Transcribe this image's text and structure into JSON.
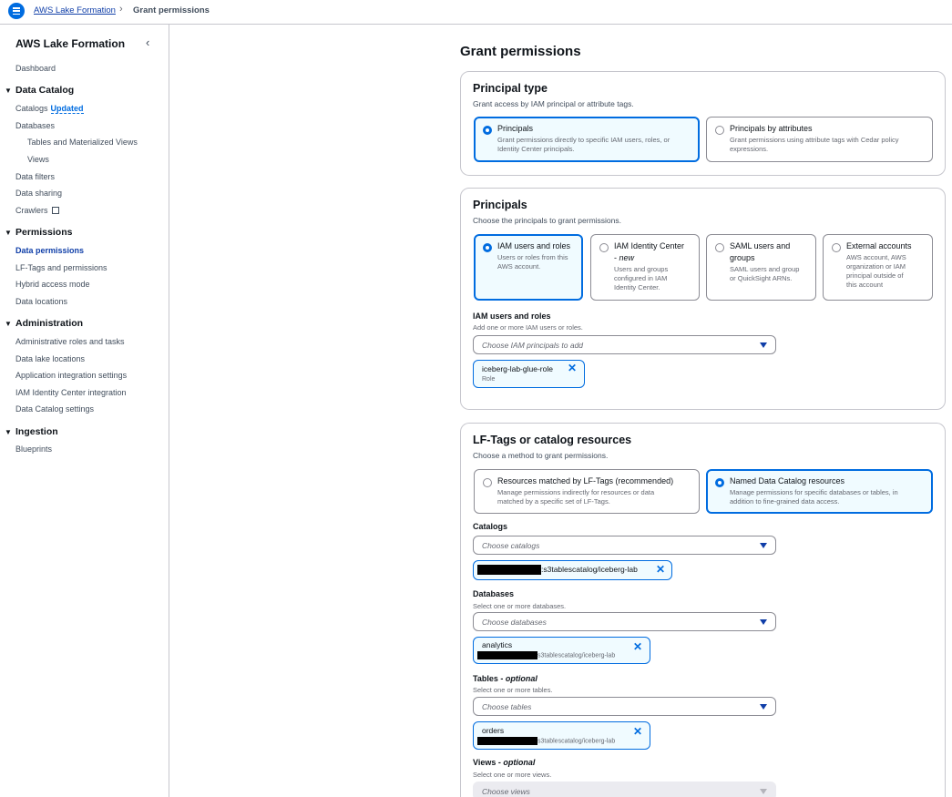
{
  "breadcrumb": {
    "service": "AWS Lake Formation",
    "current": "Grant permissions"
  },
  "sidebar": {
    "title": "AWS Lake Formation",
    "dashboard": "Dashboard",
    "sections": {
      "data_catalog": "Data Catalog",
      "permissions": "Permissions",
      "administration": "Administration",
      "ingestion": "Ingestion"
    },
    "items": {
      "catalogs": "Catalogs",
      "catalogs_badge": "Updated",
      "databases": "Databases",
      "tables": "Tables and Materialized Views",
      "views": "Views",
      "data_filters": "Data filters",
      "data_sharing": "Data sharing",
      "crawlers": "Crawlers",
      "data_permissions": "Data permissions",
      "lf_tags": "LF-Tags and permissions",
      "hybrid": "Hybrid access mode",
      "data_locations": "Data locations",
      "admin_roles": "Administrative roles and tasks",
      "data_lake_locations": "Data lake locations",
      "app_integration": "Application integration settings",
      "iam_identity_center": "IAM Identity Center integration",
      "catalog_settings": "Data Catalog settings",
      "blueprints": "Blueprints"
    }
  },
  "page": {
    "title": "Grant permissions"
  },
  "principal_type": {
    "title": "Principal type",
    "desc": "Grant access by IAM principal or attribute tags.",
    "options": [
      {
        "label": "Principals",
        "desc1": "Grant permissions directly to specific IAM users, roles, or",
        "desc2": "Identity Center principals."
      },
      {
        "label": "Principals by attributes",
        "desc1": "Grant permissions using attribute tags with Cedar policy",
        "desc2": "expressions."
      }
    ]
  },
  "principals": {
    "title": "Principals",
    "desc": "Choose the principals to grant permissions.",
    "options": [
      {
        "label": "IAM users and roles",
        "desc": [
          "Users or roles from this",
          "AWS account."
        ]
      },
      {
        "label": "IAM Identity Center",
        "label2_prefix": "- ",
        "label2_em": "new",
        "desc": [
          "Users and groups",
          "configured in IAM",
          "Identity Center."
        ]
      },
      {
        "label": "SAML users and",
        "label2": "groups",
        "desc": [
          "SAML users and group",
          "or QuickSight ARNs."
        ]
      },
      {
        "label": "External accounts",
        "desc": [
          "AWS account, AWS",
          "organization or IAM",
          "principal outside of",
          "this account"
        ]
      }
    ],
    "iam_field": {
      "label": "IAM users and roles",
      "desc": "Add one or more IAM users or roles.",
      "placeholder": "Choose IAM principals to add",
      "token_name": "iceberg-lab-glue-role",
      "token_sub": "Role"
    }
  },
  "resources": {
    "title": "LF-Tags or catalog resources",
    "desc": "Choose a method to grant permissions.",
    "options": [
      {
        "label": "Resources matched by LF-Tags (recommended)",
        "desc1": "Manage permissions indirectly for resources or data",
        "desc2": "matched by a specific set of LF-Tags."
      },
      {
        "label": "Named Data Catalog resources",
        "desc1": "Manage permissions for specific databases or tables, in",
        "desc2": "addition to fine-grained data access."
      }
    ],
    "catalogs": {
      "label": "Catalogs",
      "placeholder": "Choose catalogs",
      "token": ":s3tablescatalog/iceberg-lab"
    },
    "databases": {
      "label": "Databases",
      "desc": "Select one or more databases.",
      "placeholder": "Choose databases",
      "token_name": "analytics",
      "token_sub": "s3tablescatalog/iceberg-lab"
    },
    "tables": {
      "label": "Tables - ",
      "label_em": "optional",
      "desc": "Select one or more tables.",
      "placeholder": "Choose tables",
      "token_name": "orders",
      "token_sub": "s3tablescatalog/iceberg-lab"
    },
    "views": {
      "label": "Views - ",
      "label_em": "optional",
      "desc": "Select one or more views.",
      "placeholder": "Choose views"
    }
  }
}
